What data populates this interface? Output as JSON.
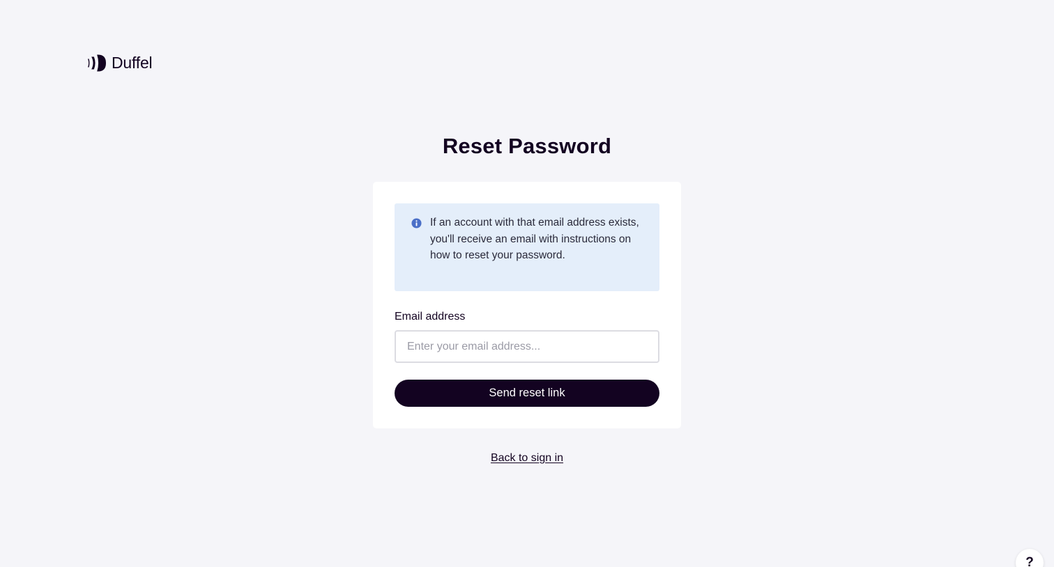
{
  "brand": {
    "name": "Duffel",
    "logo_icon": "duffel-logo-icon",
    "color": "#130321"
  },
  "page": {
    "title": "Reset Password",
    "background": "#f5f5f9"
  },
  "notice": {
    "icon": "info-icon",
    "icon_color": "#4a6fc7",
    "background": "#e4eefa",
    "text": "If an account with that email address exists, you'll receive an email with instructions on how to reset your password."
  },
  "form": {
    "email_label": "Email address",
    "email_value": "",
    "email_placeholder": "Enter your email address...",
    "submit_label": "Send reset link"
  },
  "footer": {
    "back_link_label": "Back to sign in"
  },
  "help": {
    "label": "?",
    "icon": "help-icon"
  }
}
